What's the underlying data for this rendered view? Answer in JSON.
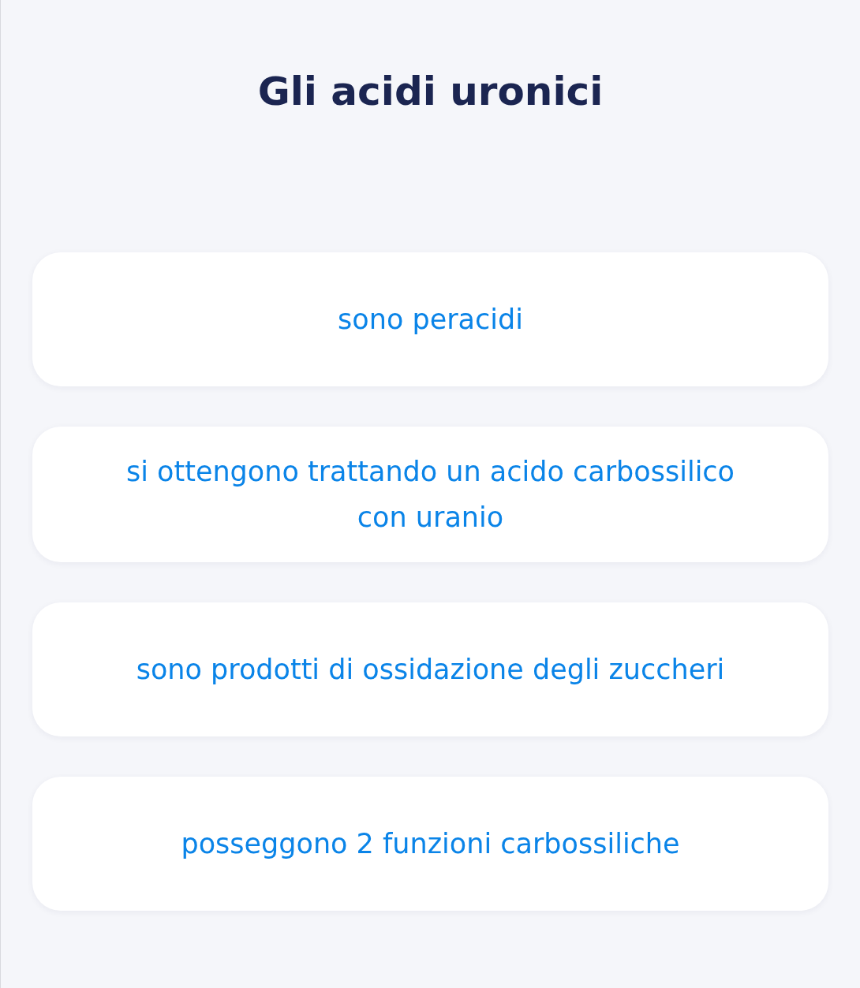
{
  "question": {
    "title": "Gli acidi uronici"
  },
  "answers": [
    {
      "text": "sono peracidi"
    },
    {
      "text": "si ottengono trattando un acido carbossilico con uranio"
    },
    {
      "text": "sono prodotti di ossidazione degli zuccheri"
    },
    {
      "text": "posseggono 2 funzioni carbossiliche"
    }
  ]
}
